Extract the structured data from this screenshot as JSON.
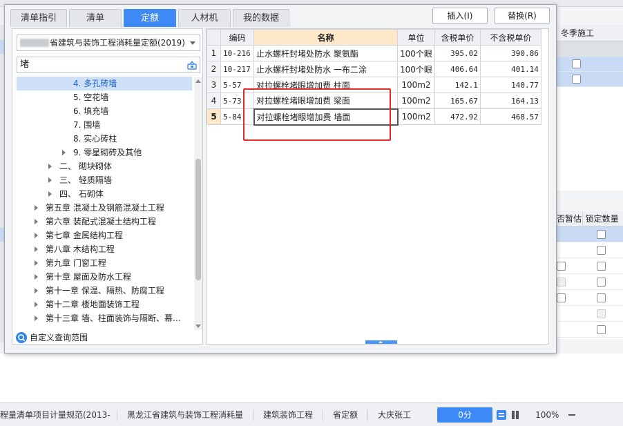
{
  "background": {
    "right_header": "冬季施工",
    "lower_headers": [
      "否暂估",
      "锁定数量"
    ]
  },
  "statusbar": {
    "items": [
      "程量清单项目计量规范(2013-",
      "黑龙江省建筑与装饰工程消耗量",
      "建筑装饰工程",
      "省定额",
      "大庆张工"
    ],
    "score": "0分",
    "zoom": "100%"
  },
  "dialog": {
    "tabs": [
      "清单指引",
      "清单",
      "定额",
      "人材机",
      "我的数据"
    ],
    "active_tab": "定额",
    "insert_button": "插入(I)",
    "replace_button": "替换(R)",
    "library": "省建筑与装饰工程消耗量定额(2019)",
    "search_value": "堵",
    "tree": [
      {
        "label": "4. 多孔砖墙",
        "selected": true
      },
      {
        "label": "5. 空花墙"
      },
      {
        "label": "6. 填充墙"
      },
      {
        "label": "7. 围墙"
      },
      {
        "label": "8. 实心砖柱"
      },
      {
        "label": "9. 零星砌砖及其他"
      },
      {
        "label": "二、  砌块砌体"
      },
      {
        "label": "三、  轻质隔墙"
      },
      {
        "label": "四、  石砌体"
      },
      {
        "label": "第五章  混凝土及钢筋混凝土工程"
      },
      {
        "label": "第六章  装配式混凝土结构工程"
      },
      {
        "label": "第七章  金属结构工程"
      },
      {
        "label": "第八章  木结构工程"
      },
      {
        "label": "第九章  门窗工程"
      },
      {
        "label": "第十章  屋面及防水工程"
      },
      {
        "label": "第十一章  保温、隔热、防腐工程"
      },
      {
        "label": "第十二章  楼地面装饰工程"
      },
      {
        "label": "第十三章  墙、柱面装饰与隔断、幕…"
      }
    ],
    "custom_range": "自定义查询范围",
    "grid": {
      "headers": [
        "编码",
        "名称",
        "单位",
        "含税单价",
        "不含税单价"
      ],
      "rows": [
        {
          "index": "1",
          "code": "10-216",
          "name": "止水螺杆封堵处防水 聚氨酯",
          "unit": "100个眼",
          "tax_price": "395.02",
          "notax_price": "390.86"
        },
        {
          "index": "2",
          "code": "10-217",
          "name": "止水螺杆封堵处防水 一布二涂",
          "unit": "100个眼",
          "tax_price": "406.64",
          "notax_price": "401.14"
        },
        {
          "index": "3",
          "code": "5-57",
          "name": "对拉螺栓堵眼增加费 柱面",
          "unit": "100m2",
          "tax_price": "142.1",
          "notax_price": "140.77"
        },
        {
          "index": "4",
          "code": "5-73",
          "name": "对拉螺栓堵眼增加费 梁面",
          "unit": "100m2",
          "tax_price": "165.67",
          "notax_price": "164.13"
        },
        {
          "index": "5",
          "code": "5-84",
          "name": "对拉螺栓堵眼增加费 墙面",
          "unit": "100m2",
          "tax_price": "472.92",
          "notax_price": "468.57"
        }
      ]
    }
  }
}
